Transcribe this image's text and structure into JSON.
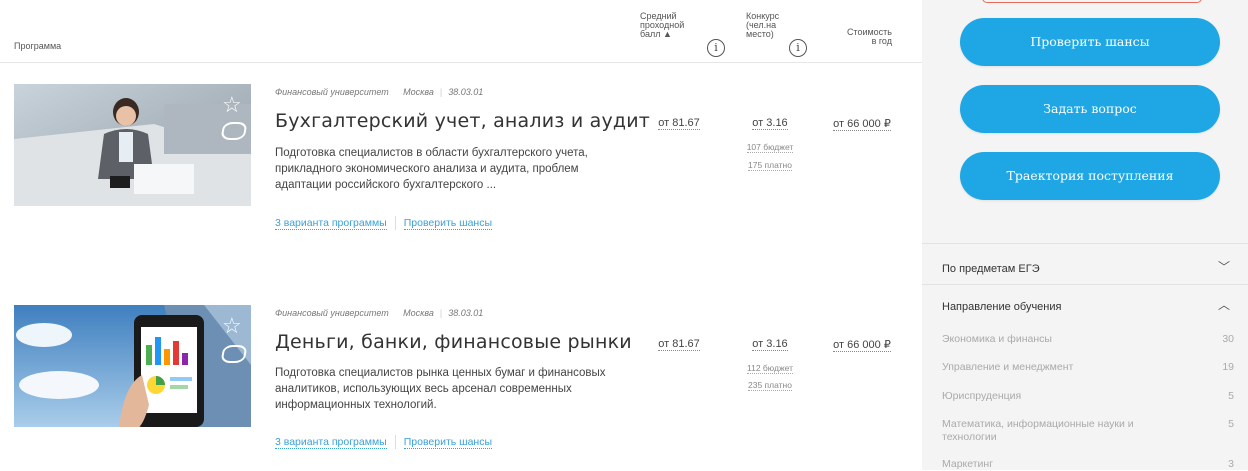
{
  "header": {
    "program": "Программа",
    "avg_score_l1": "Средний",
    "avg_score_l2": "проходной",
    "avg_score_l3": "балл ▲",
    "competition_l1": "Конкурс",
    "competition_l2": "(чел.на",
    "competition_l3": "место)",
    "cost_l1": "Стоимость",
    "cost_l2": "в год",
    "info_symbol": "i"
  },
  "programs": [
    {
      "university": "Финансовый университет",
      "city": "Москва",
      "code": "38.03.01",
      "title": "Бухгалтерский учет, анализ и аудит",
      "description": "Подготовка специалистов в области бухгалтерского учета, прикладного экономического анализа и аудита, проблем адаптации российского бухгалтерского ...",
      "variants_link": "3 варианта программы",
      "check_link": "Проверить шансы",
      "score": "от 81.67",
      "competition": "от 3.16",
      "budget": "107 бюджет",
      "paid": "175 платно",
      "cost": "от 66 000 ₽"
    },
    {
      "university": "Финансовый университет",
      "city": "Москва",
      "code": "38.03.01",
      "title": "Деньги, банки, финансовые рынки",
      "description": "Подготовка специалистов рынка ценных бумаг и финансовых аналитиков, использующих весь арсенал современных информационных технологий.",
      "variants_link": "3 варианта программы",
      "check_link": "Проверить шансы",
      "score": "от 81.67",
      "competition": "от 3.16",
      "budget": "112 бюджет",
      "paid": "235 платно",
      "cost": "от 66 000 ₽"
    }
  ],
  "sidebar": {
    "buttons": [
      "Проверить шансы",
      "Задать вопрос",
      "Траектория поступления"
    ],
    "filter_ege": "По предметам ЕГЭ",
    "filter_direction": "Направление обучения",
    "directions": [
      {
        "label": "Экономика и финансы",
        "count": "30"
      },
      {
        "label": "Управление и менеджмент",
        "count": "19"
      },
      {
        "label": "Юриспруденция",
        "count": "5"
      },
      {
        "label": "Математика, информационные науки и технологии",
        "count": "5"
      },
      {
        "label": "Маркетинг",
        "count": "3"
      }
    ],
    "accent_color": "#1ea7e4"
  }
}
